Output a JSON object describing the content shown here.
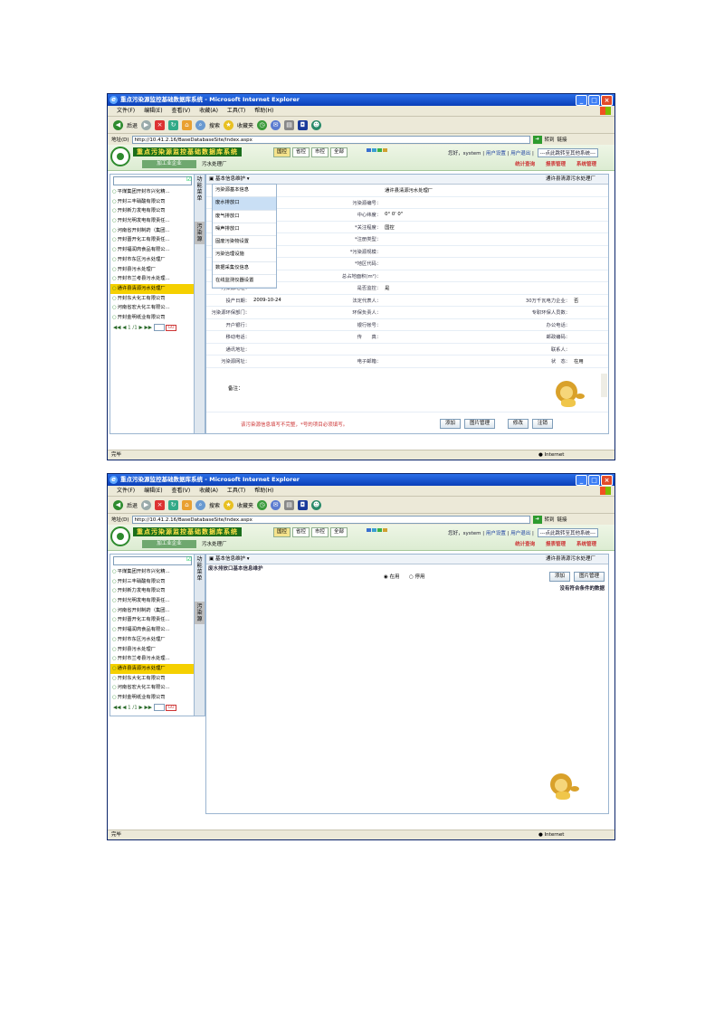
{
  "window": {
    "title": "重点污染源监控基础数据库系统 - Microsoft Internet Explorer",
    "min": "_",
    "max": "□",
    "close": "×"
  },
  "menu": [
    "文件(F)",
    "编辑(E)",
    "查看(V)",
    "收藏(A)",
    "工具(T)",
    "帮助(H)"
  ],
  "toolbar": {
    "back": "后退",
    "search": "搜索",
    "favorites": "收藏夹"
  },
  "address": {
    "label": "地址(D)",
    "url": "http://10.41.2.16/BaseDatabaseSite/Index.aspx",
    "go": "转到",
    "links": "链接"
  },
  "app": {
    "brand": "重点污染源监控基础数据库系统",
    "tabs": [
      "国控",
      "省控",
      "市控",
      "全部"
    ],
    "greeting": "您好，system",
    "user_settings": "用户设置",
    "logout": "用户退出",
    "jump": "---点此跳转至其他系统---",
    "right_links": [
      "统计查询",
      "报表管理",
      "系统管理"
    ],
    "left_tab": "加工业企业",
    "plant_crumb": "污水处理厂",
    "vnav": [
      "功能菜单",
      "污染源"
    ]
  },
  "companies": [
    "平煤集团开封市兴化精...",
    "开封三丰硝酸有限公司",
    "开封新力发电有限公司",
    "开封光明发电有限责任...",
    "河南省开封制药（集团...",
    "开封晋开化工有限责任...",
    "开封福润肉食品有限公...",
    "开封市东区污水处理厂",
    "开封县污水处理厂",
    "开封市兰考县污水处理...",
    "通许县清源污水处理厂",
    "开封东大化工有限公司",
    "河南省宏大化工有限公...",
    "开封金明纸业有限公司"
  ],
  "pager": {
    "text": "◀◀ ◀ 1 /1 ▶ ▶▶",
    "go": "GO"
  },
  "shot1": {
    "section": "基本信息维护",
    "plant": "通许县清源污水处理厂",
    "menu": [
      "污染源基本信息",
      "废水排放口",
      "废气排放口",
      "噪声排放口",
      "固废污染物设置",
      "污染治理设施",
      "数据采集仪信息",
      "在线监测仪器设置"
    ],
    "rows": [
      [
        "",
        "",
        "",
        "通许县清源污水处理厂",
        "",
        ""
      ],
      [
        "",
        "开封市",
        "污染源编号：",
        "",
        "",
        ""
      ],
      [
        "",
        "",
        "中心纬度：",
        "0° 0' 0\"",
        "",
        ""
      ],
      [
        "",
        "",
        "*关注程度：",
        "国控",
        "",
        ""
      ],
      [
        "",
        "",
        "*注册类型：",
        "",
        "",
        ""
      ],
      [
        "",
        "",
        "*污染源规模：",
        "",
        "",
        ""
      ],
      [
        "",
        "",
        "*地区代码：",
        "",
        "",
        ""
      ],
      [
        "",
        "",
        "总占地面积(m²)：",
        "",
        "",
        ""
      ],
      [
        "污染源地址：",
        "",
        "是否监控：",
        "是",
        "",
        ""
      ],
      [
        "投产日期：",
        "2009-10-24",
        "法定代表人：",
        "",
        "30万千瓦电力企业：",
        "否"
      ],
      [
        "污染源环保部门：",
        "",
        "环保负责人：",
        "",
        "专职环保人员数：",
        ""
      ],
      [
        "开户银行：",
        "",
        "银行帐号：",
        "",
        "办公电话：",
        ""
      ],
      [
        "移动电话：",
        "",
        "传　　真：",
        "",
        "邮政编码：",
        ""
      ],
      [
        "通讯地址：",
        "",
        "",
        "",
        "联系人：",
        ""
      ],
      [
        "污染源网址：",
        "",
        "电子邮箱：",
        "",
        "状　态：",
        "在用"
      ]
    ],
    "remark": "备注：",
    "warning": "该污染源信息填写不完整，*号的项目必须填写。",
    "buttons": [
      "添加",
      "图片管理",
      "修改",
      "注销"
    ]
  },
  "shot2": {
    "section": "基本信息维护",
    "plant": "通许县清源污水处理厂",
    "sub": "废水排放口基本信息维护",
    "radio_on": "◉ 在用",
    "radio_off": "○ 停用",
    "buttons": [
      "添加",
      "图片管理"
    ],
    "empty": "没有符合条件的数据"
  },
  "status": {
    "done": "完毕",
    "zone": "Internet"
  }
}
